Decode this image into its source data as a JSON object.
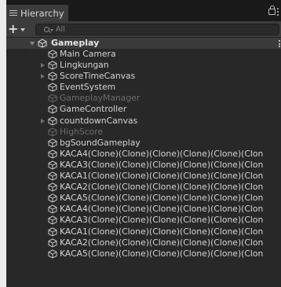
{
  "window": {
    "tab_label": "Hierarchy"
  },
  "toolbar": {
    "search_placeholder": "All"
  },
  "scene": {
    "name": "Gameplay"
  },
  "objects": [
    {
      "name": "Main Camera",
      "has_children": false,
      "active": true
    },
    {
      "name": "Lingkungan",
      "has_children": true,
      "active": true
    },
    {
      "name": "ScoreTimeCanvas",
      "has_children": true,
      "active": true
    },
    {
      "name": "EventSystem",
      "has_children": false,
      "active": true
    },
    {
      "name": "GameplayManager",
      "has_children": false,
      "active": false
    },
    {
      "name": "GameController",
      "has_children": false,
      "active": true
    },
    {
      "name": "countdownCanvas",
      "has_children": true,
      "active": true
    },
    {
      "name": "HighScore",
      "has_children": false,
      "active": false
    },
    {
      "name": "bgSoundGameplay",
      "has_children": false,
      "active": true
    },
    {
      "name": "KACA4(Clone)(Clone)(Clone)(Clone)(Clone)(Clon",
      "has_children": false,
      "active": true
    },
    {
      "name": "KACA3(Clone)(Clone)(Clone)(Clone)(Clone)(Clon",
      "has_children": false,
      "active": true
    },
    {
      "name": "KACA1(Clone)(Clone)(Clone)(Clone)(Clone)(Clon",
      "has_children": false,
      "active": true
    },
    {
      "name": "KACA2(Clone)(Clone)(Clone)(Clone)(Clone)(Clon",
      "has_children": false,
      "active": true
    },
    {
      "name": "KACA5(Clone)(Clone)(Clone)(Clone)(Clone)(Clon",
      "has_children": false,
      "active": true
    },
    {
      "name": "KACA4(Clone)(Clone)(Clone)(Clone)(Clone)(Clon",
      "has_children": false,
      "active": true
    },
    {
      "name": "KACA3(Clone)(Clone)(Clone)(Clone)(Clone)(Clon",
      "has_children": false,
      "active": true
    },
    {
      "name": "KACA1(Clone)(Clone)(Clone)(Clone)(Clone)(Clon",
      "has_children": false,
      "active": true
    },
    {
      "name": "KACA2(Clone)(Clone)(Clone)(Clone)(Clone)(Clon",
      "has_children": false,
      "active": true
    },
    {
      "name": "KACA5(Clone)(Clone)(Clone)(Clone)(Clone)(Clon",
      "has_children": false,
      "active": true
    }
  ],
  "icons": {
    "tab": "hamburger-menu-icon",
    "lock": "lock-icon",
    "more": "kebab-menu-icon",
    "add": "plus-icon",
    "search": "search-icon",
    "scene": "unity-scene-icon",
    "gameobject": "gameobject-cube-icon"
  },
  "colors": {
    "panel": "#282828",
    "tab_bar": "#191919",
    "toolbar": "#3c3c3c",
    "scene_row": "#3a3a3a",
    "active_text": "#d4d4d4",
    "inactive_text": "#6b6b6b"
  }
}
